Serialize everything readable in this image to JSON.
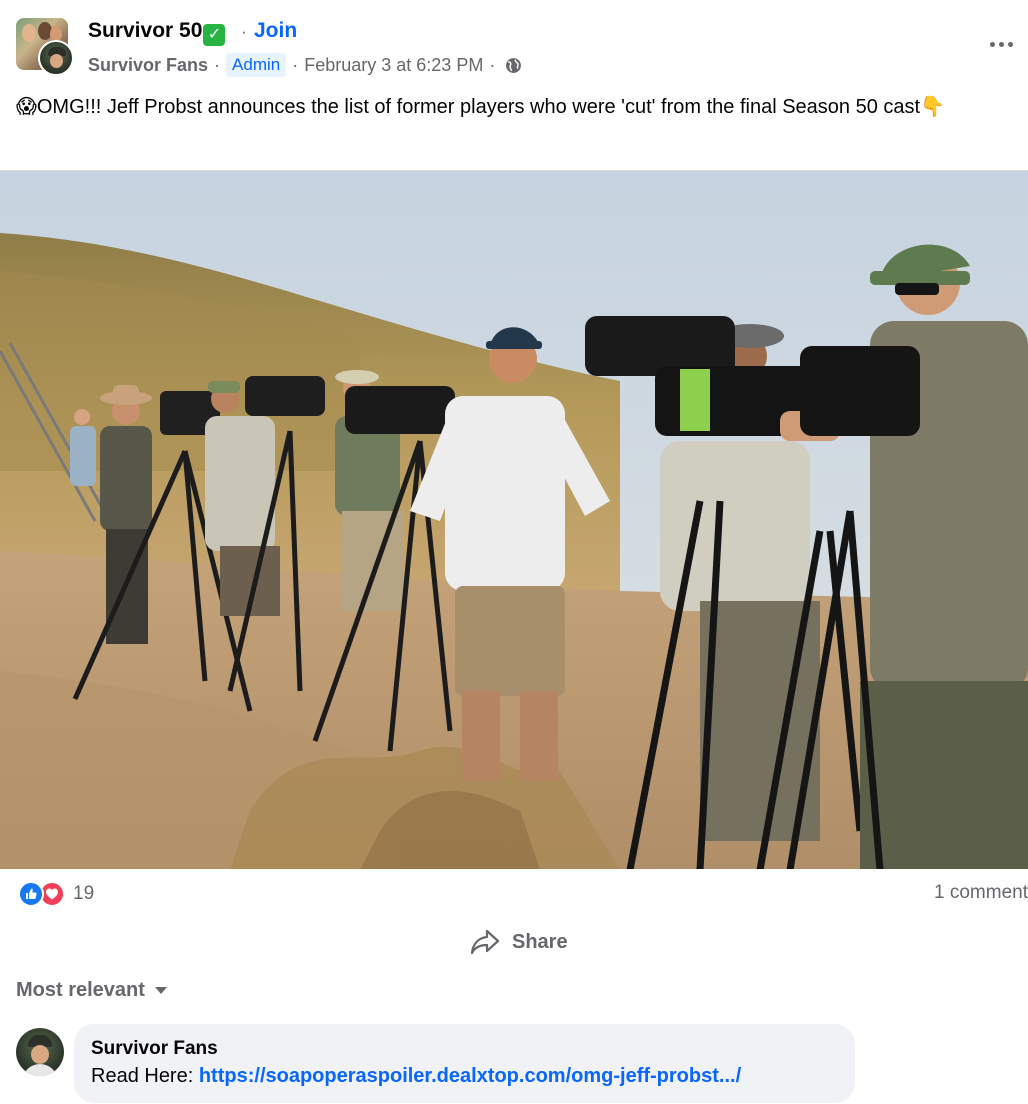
{
  "post": {
    "group_name": "Survivor 50",
    "verified_emoji": "✅",
    "join_separator": "·",
    "join_label": "Join",
    "author": "Survivor Fans",
    "separator": "·",
    "admin_badge": "Admin",
    "timestamp": "February 3 at 6:23 PM",
    "privacy_icon": "globe-icon",
    "more_icon": "more-horizontal-icon",
    "text_emoji_start": "😱",
    "text": "OMG!!! Jeff Probst announces the list of former players who were 'cut' from the final Season 50 cast",
    "text_emoji_end": "👇"
  },
  "stats": {
    "reaction_icons": [
      "like-icon",
      "love-icon"
    ],
    "reaction_count": "19",
    "comment_count": "1 comment"
  },
  "actions": {
    "share_label": "Share",
    "share_icon": "share-arrow-icon"
  },
  "comments_section": {
    "sort_label": "Most relevant",
    "comments": [
      {
        "author": "Survivor Fans",
        "prefix": "Read Here: ",
        "link": "https://soapoperaspoiler.dealxtop.com/omg-jeff-probst.../"
      }
    ]
  },
  "colors": {
    "accent": "#0866ff",
    "secondary_text": "#65676b",
    "like_blue": "#1877f2",
    "love_red": "#f33e58",
    "bubble_bg": "#f0f2f5"
  }
}
